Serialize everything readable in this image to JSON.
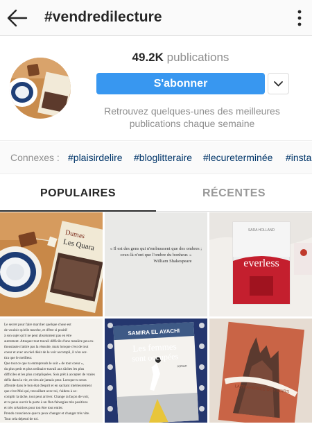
{
  "header": {
    "title": "#vendredilecture",
    "back_icon": "back-arrow-icon",
    "more_icon": "more-vertical-icon"
  },
  "profile": {
    "pub_count": "49.2K",
    "pub_label": " publications",
    "follow_label": "S'abonner",
    "description": "Retrouvez quelques-unes des meilleures publications chaque semaine"
  },
  "related": {
    "label": "Connexes :",
    "tags": [
      "#plaisirdelire",
      "#bloglitteraire",
      "#lecureterminée",
      "#insta"
    ]
  },
  "tabs": {
    "popular": "POPULAIRES",
    "recent": "RÉCENTES"
  },
  "grid": {
    "post1": {
      "book_brand": "Dumas",
      "book_title": "Les Quara"
    },
    "post2": {
      "quote_line1": "« Il est des gens qui n'embrassent que des ombres ;",
      "quote_line2": "ceux-là n'ont que l'ombre du bonheur. »",
      "quote_author": "William Shakespeare"
    },
    "post3": {
      "book_author": "SARA HOLLAND",
      "book_title": "everless"
    },
    "post4": {
      "text_lines": [
        "Le secret pour faire marcher quelque chose est",
        "de vouloir qu'elle marche, et d'être si positif",
        "à son sujet qu'il ne peut absolument pas en être",
        "autrement. Attaquer tout travail difficile d'une manière peu en-",
        "thousiaste n'attire pas la réussite, mais lorsque c'est de tout",
        "coeur et avec un réel désir de le voir accompli, il n'en sor-",
        "tira que le meilleur.",
        "Que tout ce que tu entreprends le soit « de tout coeur »,",
        "du plus petit et plus ordinaire travail aux tâches les plus",
        "difficiles et les plus compliquées. Sois prêt à accepter de vraies",
        "défis dans la vie, et n'en aie jamais peur. Lorsque tu seras",
        "affronté dans le bon état d'esprit et en sachant intérieurement",
        "que c'est Moi qui, travaillant avec toi, t'aidera à ac-",
        "complir la tâche, tout peut arriver. Change ta façon de voir,",
        "et tu peux ouvrir la porte à un flot d'énergies très positives",
        "et très créatrices pour ton être tout entier.",
        "Prends conscience que tu peux changer et changer très vite.",
        "Tout cela dépend de toi."
      ]
    },
    "post5": {
      "book_author": "SAMIRA EL AYACHI",
      "book_title_1": "Les femmes",
      "book_title_2": "sont occupées",
      "book_subtitle": "roman"
    },
    "post6": {
      "book_title": "LA TRAVERSÉE DES SOIRS"
    }
  },
  "colors": {
    "accent": "#3897f0",
    "tag": "#003569",
    "muted": "#8e8e8e",
    "border": "#dbdbdb"
  }
}
